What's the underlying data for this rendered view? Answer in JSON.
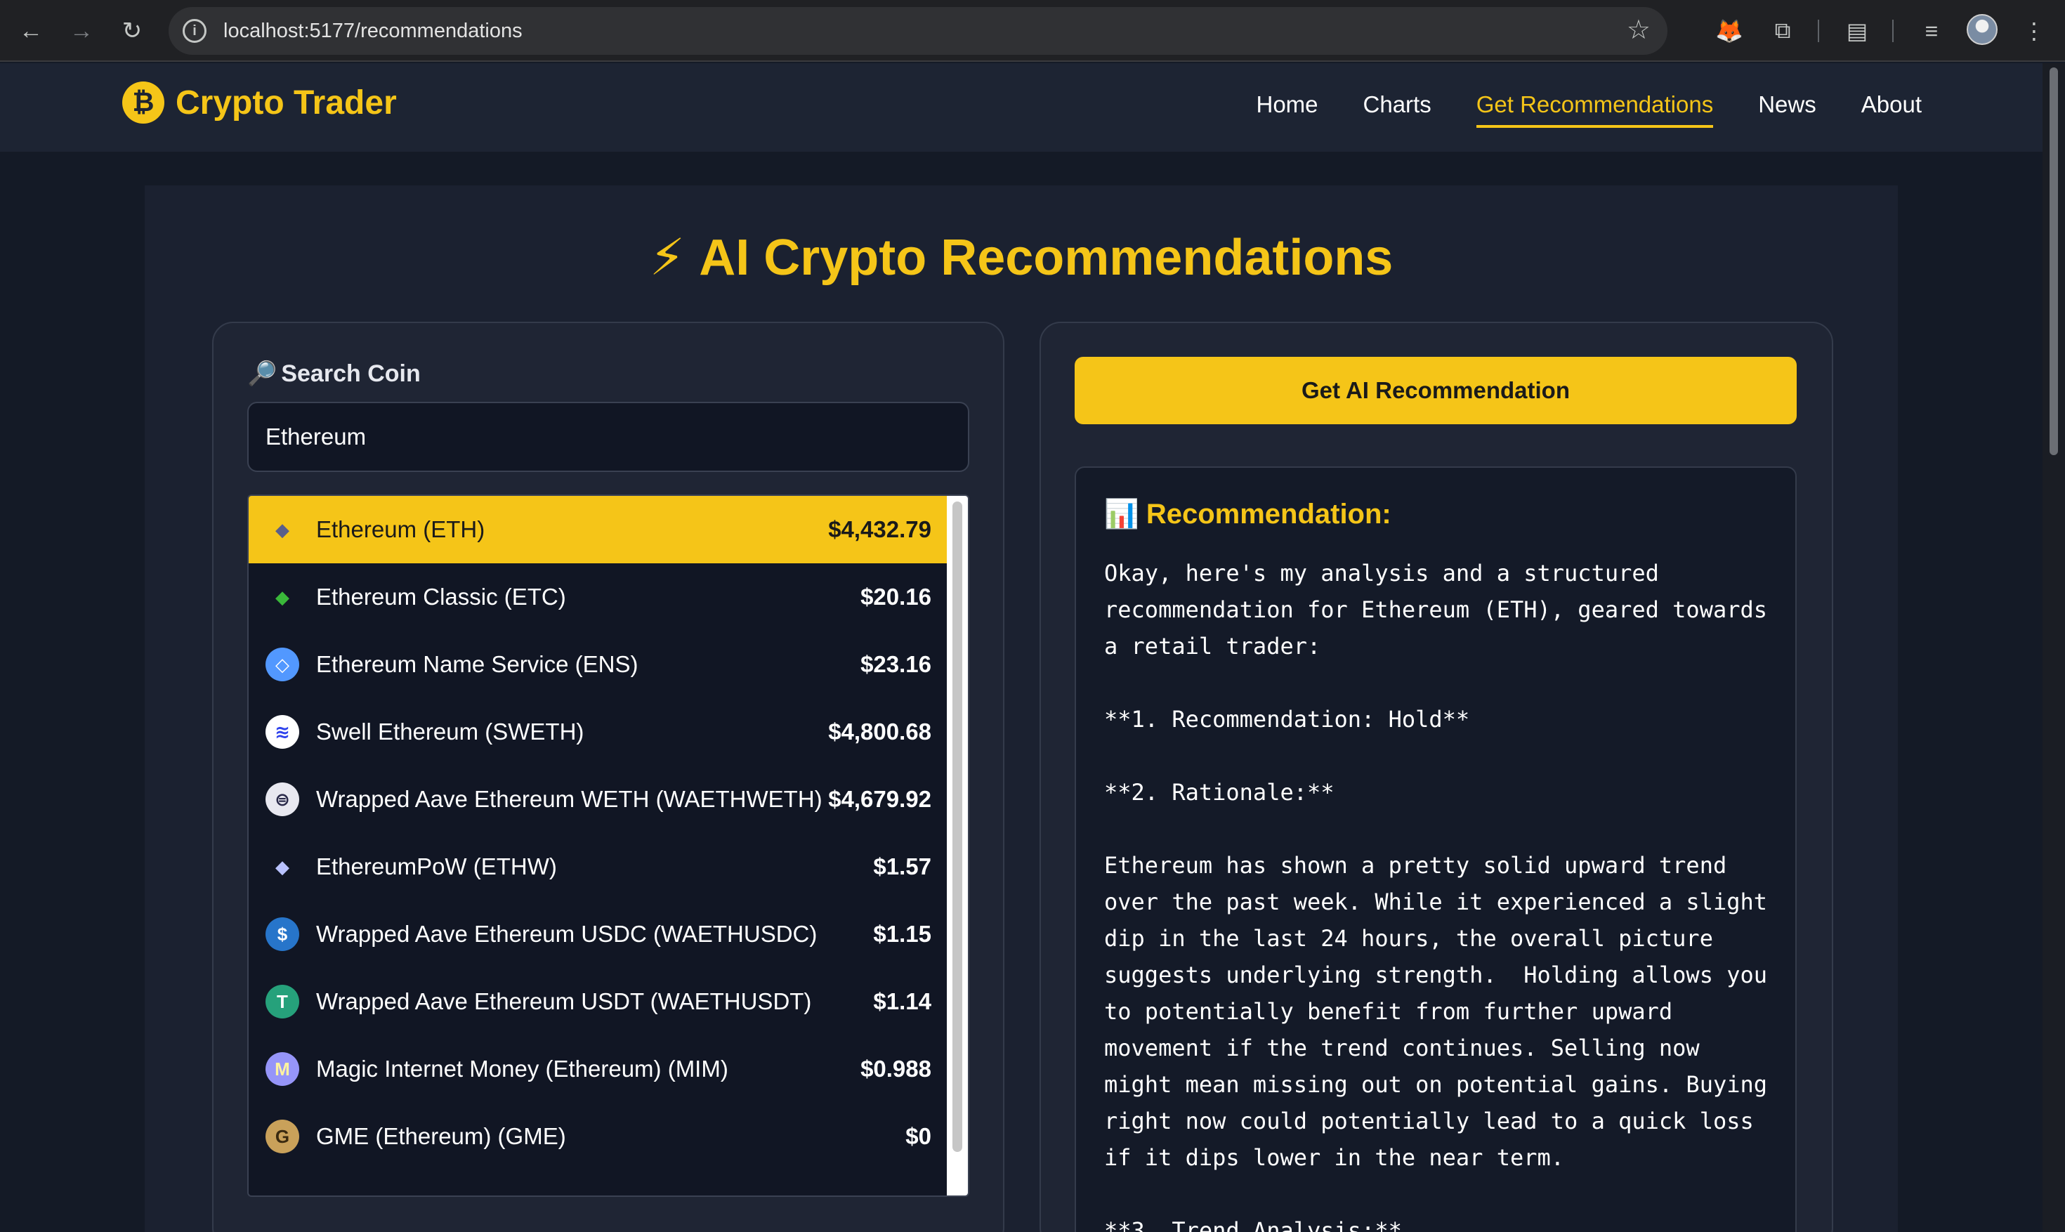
{
  "browser": {
    "url": "localhost:5177/recommendations",
    "icons": [
      "back-arrow-icon",
      "forward-arrow-icon",
      "reload-icon",
      "info-icon",
      "star-icon",
      "fox-extension-icon",
      "puzzle-extension-icon",
      "reading-list-icon",
      "media-queue-icon",
      "profile-avatar",
      "kebab-menu-icon"
    ]
  },
  "site": {
    "logo_glyph": "₿",
    "brand": "Crypto Trader",
    "nav": [
      {
        "label": "Home",
        "active": false
      },
      {
        "label": "Charts",
        "active": false
      },
      {
        "label": "Get Recommendations",
        "active": true
      },
      {
        "label": "News",
        "active": false
      },
      {
        "label": "About",
        "active": false
      }
    ],
    "accent": "#f5c518"
  },
  "page": {
    "title_icon": "⚡",
    "title": "AI Crypto Recommendations"
  },
  "search": {
    "label_icon": "🔎",
    "label": "Search Coin",
    "value": "Ethereum"
  },
  "coins": [
    {
      "name": "Ethereum (ETH)",
      "price": "$4,432.79",
      "icon": "ethereum-icon",
      "glyph": "◆",
      "selected": true
    },
    {
      "name": "Ethereum Classic (ETC)",
      "price": "$20.16",
      "icon": "ethereum-classic-icon",
      "glyph": "◆",
      "selected": false
    },
    {
      "name": "Ethereum Name Service (ENS)",
      "price": "$23.16",
      "icon": "ens-icon",
      "glyph": "◇",
      "selected": false
    },
    {
      "name": "Swell Ethereum (SWETH)",
      "price": "$4,800.68",
      "icon": "swell-icon",
      "glyph": "≋",
      "selected": false
    },
    {
      "name": "Wrapped Aave Ethereum WETH (WAETHWETH)",
      "price": "$4,679.92",
      "icon": "aave-weth-icon",
      "glyph": "⊜",
      "selected": false
    },
    {
      "name": "EthereumPoW (ETHW)",
      "price": "$1.57",
      "icon": "ethereumpow-icon",
      "glyph": "◆",
      "selected": false
    },
    {
      "name": "Wrapped Aave Ethereum USDC (WAETHUSDC)",
      "price": "$1.15",
      "icon": "aave-usdc-icon",
      "glyph": "$",
      "selected": false
    },
    {
      "name": "Wrapped Aave Ethereum USDT (WAETHUSDT)",
      "price": "$1.14",
      "icon": "aave-usdt-icon",
      "glyph": "T",
      "selected": false
    },
    {
      "name": "Magic Internet Money (Ethereum) (MIM)",
      "price": "$0.988",
      "icon": "mim-icon",
      "glyph": "M",
      "selected": false
    },
    {
      "name": "GME (Ethereum) (GME)",
      "price": "$0",
      "icon": "gme-icon",
      "glyph": "G",
      "selected": false
    }
  ],
  "recommendation": {
    "button_label": "Get AI Recommendation",
    "title_icon": "📊",
    "title": "Recommendation:",
    "text": "Okay, here's my analysis and a structured recommendation for Ethereum (ETH), geared towards a retail trader:\n\n**1. Recommendation: Hold**\n\n**2. Rationale:**\n\nEthereum has shown a pretty solid upward trend over the past week. While it experienced a slight dip in the last 24 hours, the overall picture suggests underlying strength.  Holding allows you to potentially benefit from further upward movement if the trend continues. Selling now might mean missing out on potential gains. Buying right now could potentially lead to a quick loss if it dips lower in the near term.\n\n**3. Trend Analysis:**"
  }
}
